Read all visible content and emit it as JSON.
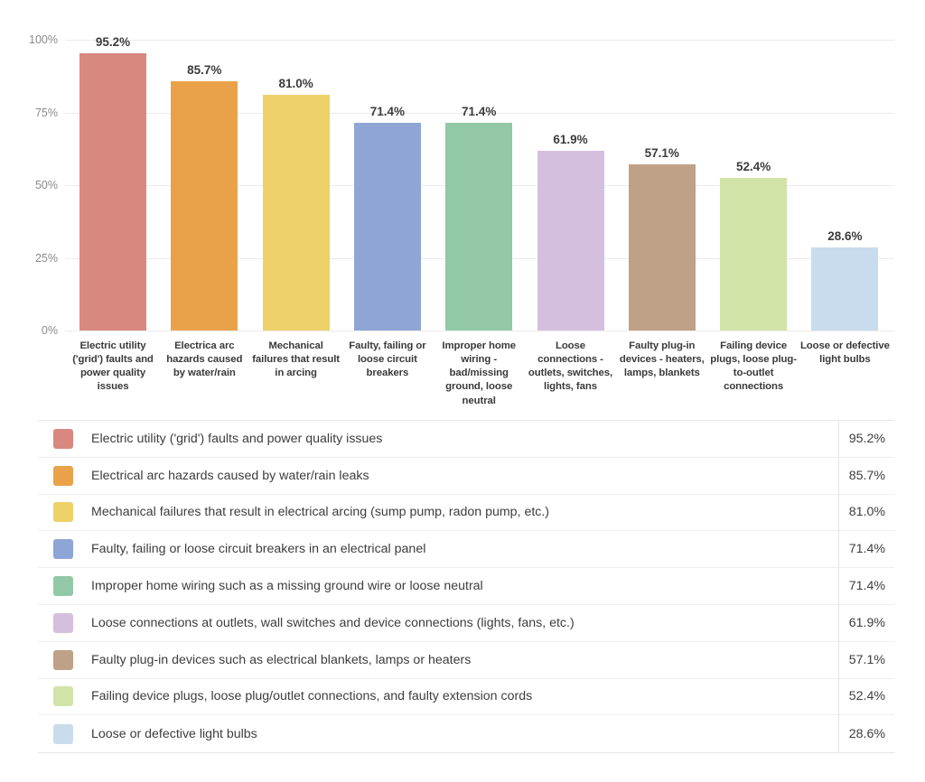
{
  "chart_data": {
    "type": "bar",
    "title": "",
    "subtitle": "",
    "xlabel": "",
    "ylabel": "",
    "ylim": [
      0,
      100
    ],
    "grid": true,
    "legend_position": "bottom-table",
    "y_ticks": [
      "0%",
      "25%",
      "50%",
      "75%",
      "100%"
    ],
    "y_tick_values": [
      0,
      25,
      50,
      75,
      100
    ],
    "categories": [
      "Electric utility ('grid') faults and power quality issues",
      "Electrica arc hazards caused by water/rain",
      "Mechanical failures that result in arcing",
      "Faulty, failing or loose circuit breakers",
      "Improper home wiring - bad/missing ground, loose neutral",
      "Loose connections - outlets, switches, lights, fans",
      "Faulty plug-in devices - heaters, lamps, blankets",
      "Failing device plugs, loose plug-to-outlet connections",
      "Loose or defective light bulbs"
    ],
    "values": [
      95.2,
      85.7,
      81.0,
      71.4,
      71.4,
      61.9,
      57.1,
      52.4,
      28.6
    ],
    "value_labels": [
      "95.2%",
      "85.7%",
      "81.0%",
      "71.4%",
      "71.4%",
      "61.9%",
      "57.1%",
      "52.4%",
      "28.6%"
    ],
    "colors": [
      "#d98880",
      "#e9a24a",
      "#eed169",
      "#8fa5d5",
      "#93c8a6",
      "#d5bfdf",
      "#bfa187",
      "#d2e3a8",
      "#c9dced"
    ]
  },
  "legend": {
    "rows": [
      {
        "label": "Electric utility ('grid') faults and power quality issues",
        "value": "95.2%",
        "color": "#d98880"
      },
      {
        "label": "Electrical arc hazards caused by water/rain leaks",
        "value": "85.7%",
        "color": "#e9a24a"
      },
      {
        "label": "Mechanical failures that result in electrical arcing (sump pump, radon pump, etc.)",
        "value": "81.0%",
        "color": "#eed169"
      },
      {
        "label": "Faulty, failing or loose circuit breakers in an electrical panel",
        "value": "71.4%",
        "color": "#8fa5d5"
      },
      {
        "label": "Improper home wiring such as a missing ground wire or loose neutral",
        "value": "71.4%",
        "color": "#93c8a6"
      },
      {
        "label": "Loose connections at outlets, wall switches and device connections (lights, fans, etc.)",
        "value": "61.9%",
        "color": "#d5bfdf"
      },
      {
        "label": "Faulty plug-in devices such as electrical blankets, lamps or heaters",
        "value": "57.1%",
        "color": "#bfa187"
      },
      {
        "label": "Failing device plugs, loose plug/outlet connections, and faulty extension cords",
        "value": "52.4%",
        "color": "#d2e3a8"
      },
      {
        "label": "Loose or defective light bulbs",
        "value": "28.6%",
        "color": "#c9dced"
      }
    ]
  }
}
